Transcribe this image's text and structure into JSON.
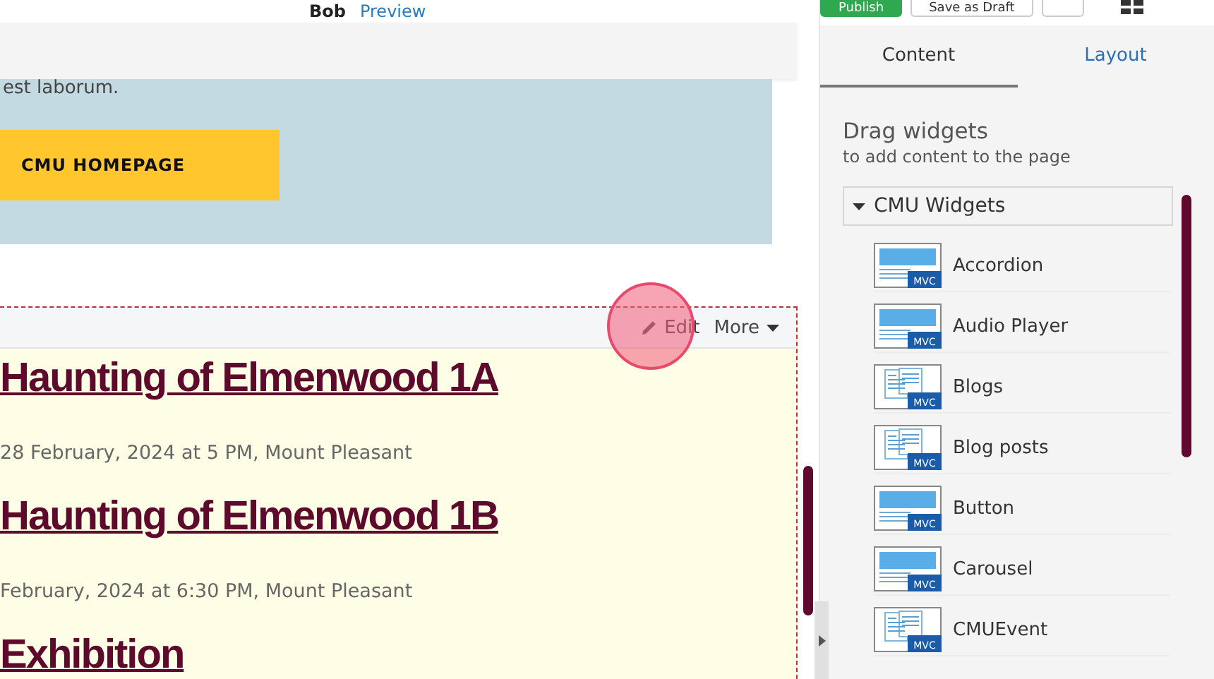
{
  "header": {
    "page_name": "Bob",
    "preview_link": "Preview",
    "buttons": [
      {
        "label": "Publish",
        "kind": "primary"
      },
      {
        "label": "Save as Draft",
        "kind": "secondary"
      },
      {
        "kind": "blank"
      }
    ]
  },
  "canvas": {
    "intro_text": "est laborum.",
    "cta_button": "CMU HOMEPAGE",
    "widget_toolbar": {
      "edit": "Edit",
      "more": "More"
    },
    "events": [
      {
        "title": "Haunting of Elmenwood 1A",
        "details": "28 February, 2024 at 5 PM, Mount Pleasant"
      },
      {
        "title": "Haunting of Elmenwood 1B",
        "details": "February, 2024 at 6:30 PM, Mount Pleasant"
      },
      {
        "title": "Exhibition"
      }
    ]
  },
  "sidebar": {
    "tabs": [
      {
        "label": "Content",
        "selected": true
      },
      {
        "label": "Layout",
        "selected": false
      }
    ],
    "heading": "Drag widgets",
    "subheading": "to add content to the page",
    "group": {
      "label": "CMU Widgets",
      "expanded": true
    },
    "widgets": [
      {
        "label": "Accordion",
        "kind": "banner",
        "badge": "MVC"
      },
      {
        "label": "Audio Player",
        "kind": "banner",
        "badge": "MVC"
      },
      {
        "label": "Blogs",
        "kind": "document",
        "badge": "MVC"
      },
      {
        "label": "Blog posts",
        "kind": "document",
        "badge": "MVC"
      },
      {
        "label": "Button",
        "kind": "banner",
        "badge": "MVC"
      },
      {
        "label": "Carousel",
        "kind": "banner",
        "badge": "MVC"
      },
      {
        "label": "CMUEvent",
        "kind": "document",
        "badge": "MVC"
      }
    ]
  }
}
